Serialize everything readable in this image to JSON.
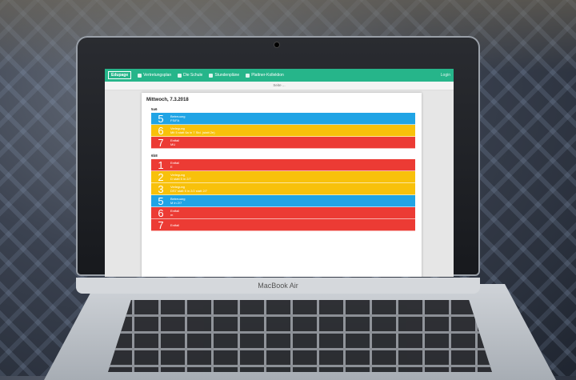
{
  "laptop": {
    "model": "MacBook Air"
  },
  "app": {
    "brand": "Edupage",
    "nav": [
      {
        "label": "Vertretungsplan",
        "icon": "calendar-icon"
      },
      {
        "label": "Die Schule",
        "icon": "school-icon"
      },
      {
        "label": "Stundenpläne",
        "icon": "grid-icon"
      },
      {
        "label": "Plattner-Kollektion",
        "icon": "bookmark-icon"
      }
    ],
    "login_label": "Login",
    "subbar_text": "Seite ..."
  },
  "schedule": {
    "date": "Mittwoch, 7.3.2018",
    "groups": [
      {
        "name": "5a6",
        "rows": [
          {
            "num": "5",
            "type": "Betreuung",
            "detail": "FS/FA",
            "color": "blue"
          },
          {
            "num": "6",
            "type": "Verlegung",
            "detail": "Mit 5 statt 6a in 7 Std. (statt 2e)",
            "color": "yellow"
          },
          {
            "num": "7",
            "type": "Entfall",
            "detail": "MU",
            "color": "red"
          }
        ]
      },
      {
        "name": "6b8",
        "rows": [
          {
            "num": "1",
            "type": "Entfall",
            "detail": "E",
            "color": "red"
          },
          {
            "num": "2",
            "type": "Verlegung",
            "detail": "D statt 5 in 2/7",
            "color": "yellow"
          },
          {
            "num": "3",
            "type": "Verlegung",
            "detail": "DS7 statt 5 in 2/2 statt 2/7",
            "color": "yellow"
          },
          {
            "num": "5",
            "type": "Betreuung",
            "detail": "M in 2/7",
            "color": "blue"
          },
          {
            "num": "6",
            "type": "Entfall",
            "detail": "m",
            "color": "red"
          },
          {
            "num": "7",
            "type": "Entfall",
            "detail": "",
            "color": "red"
          }
        ]
      }
    ]
  }
}
